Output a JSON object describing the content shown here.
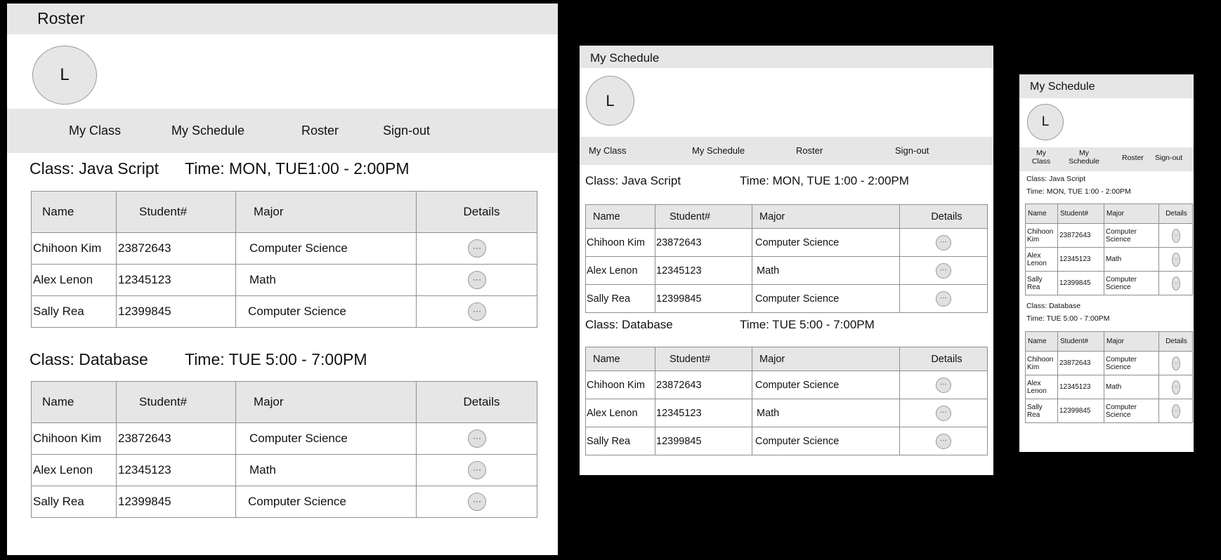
{
  "screens": [
    {
      "title": "Roster",
      "avatar_initial": "L",
      "nav": [
        "My Class",
        "My Schedule",
        "Roster",
        "Sign-out"
      ],
      "classes": [
        {
          "class_label": "Class: Java Script",
          "time_label": "Time: MON, TUE1:00 - 2:00PM"
        },
        {
          "class_label": "Class: Database",
          "time_label": "Time: TUE 5:00 - 7:00PM"
        }
      ]
    },
    {
      "title": "My Schedule",
      "avatar_initial": "L",
      "nav": [
        "My Class",
        "My Schedule",
        "Roster",
        "Sign-out"
      ],
      "classes": [
        {
          "class_label": "Class: Java Script",
          "time_label": "Time: MON, TUE 1:00 - 2:00PM"
        },
        {
          "class_label": "Class: Database",
          "time_label": "Time: TUE 5:00 - 7:00PM"
        }
      ]
    },
    {
      "title": "My Schedule",
      "avatar_initial": "L",
      "nav": [
        "My Class",
        "My Schedule",
        "Roster",
        "Sign-out"
      ],
      "classes": [
        {
          "class_label": "Class: Java Script",
          "time_label": "Time: MON, TUE 1:00 - 2:00PM"
        },
        {
          "class_label": "Class: Database",
          "time_label": "Time: TUE 5:00 - 7:00PM"
        }
      ]
    }
  ],
  "table": {
    "headers": [
      "Name",
      "Student#",
      "Major",
      "Details"
    ],
    "rows": [
      [
        "Chihoon Kim",
        "23872643",
        "Computer Science"
      ],
      [
        "Alex Lenon",
        "12345123",
        "Math"
      ],
      [
        "Sally Rea",
        "12399845",
        "Computer Science"
      ]
    ],
    "details_glyph": "···"
  },
  "colors": {
    "background": "#000000",
    "panel": "#ffffff",
    "bar": "#e6e6e6",
    "border": "#8f8f8f"
  },
  "icons": {
    "details": "more-dots-icon",
    "avatar": "user-avatar"
  }
}
